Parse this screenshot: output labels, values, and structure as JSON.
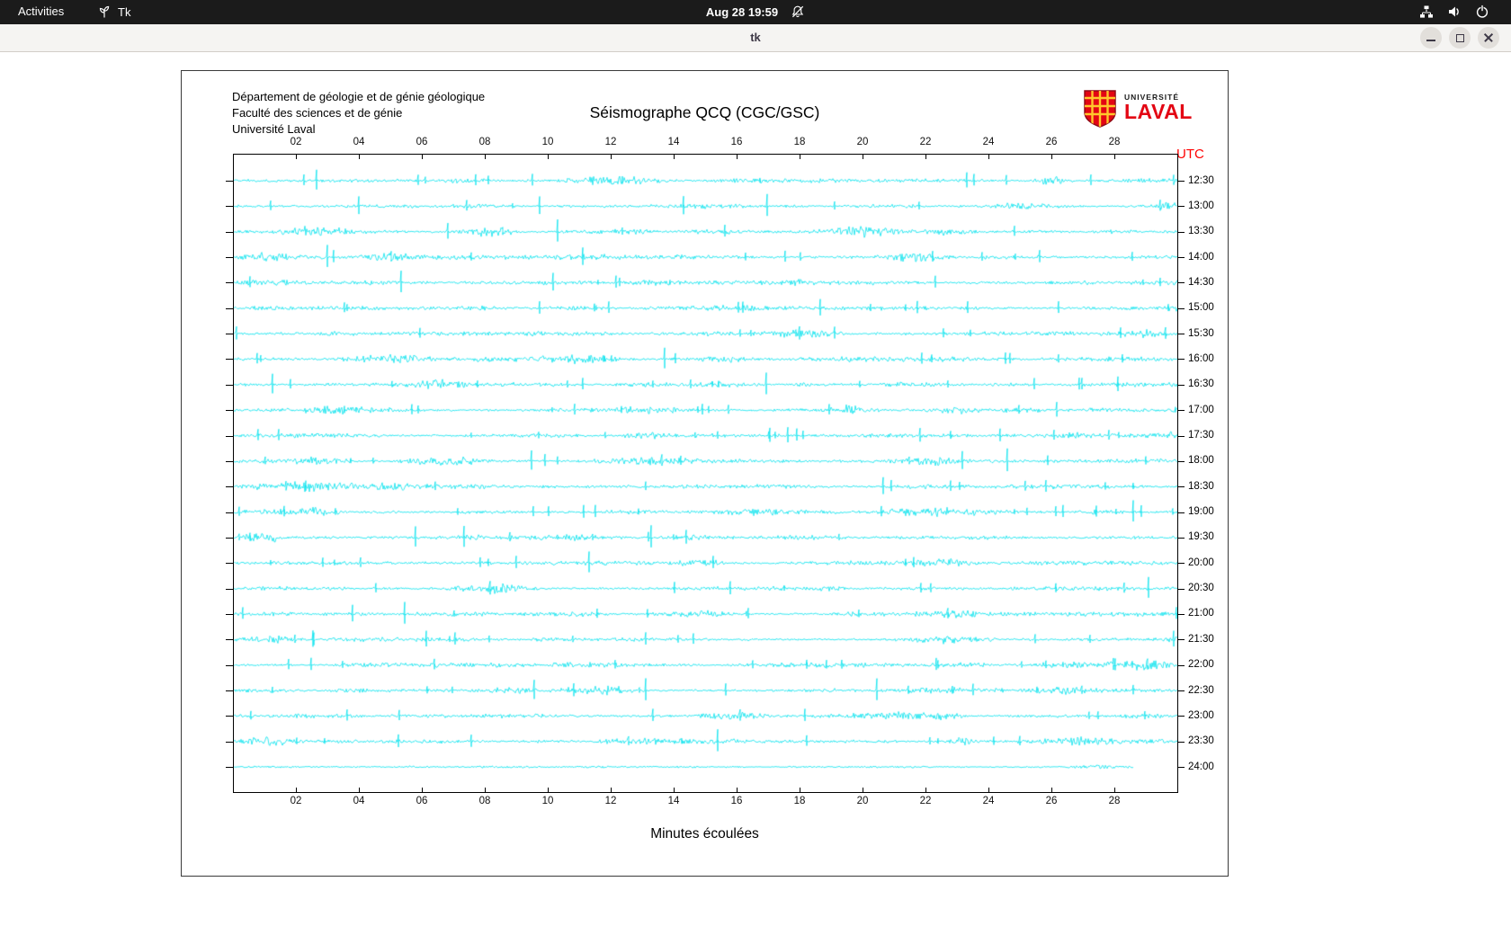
{
  "top_bar": {
    "activities": "Activities",
    "app_name": "Tk",
    "clock": "Aug 28 19:59"
  },
  "window": {
    "title": "tk"
  },
  "seismograph": {
    "institution": [
      "Département de géologie et de génie géologique",
      "Faculté des sciences et de génie",
      "Université Laval"
    ],
    "title": "Séismographe QCQ (CGC/GSC)",
    "utc_label": "UTC",
    "x_axis_title": "Minutes écoulées",
    "logo": {
      "line1": "UNIVERSITÉ",
      "line2": "LAVAL"
    },
    "colors": {
      "trace": "#00e2ee",
      "utc": "#ff0000",
      "laval_red": "#e30513",
      "laval_yellow": "#ffc72c"
    }
  },
  "chart_data": {
    "type": "line",
    "subtype": "helicorder-seismogram",
    "title": "Séismographe QCQ (CGC/GSC)",
    "xlabel": "Minutes écoulées",
    "x_ticks": [
      "02",
      "04",
      "06",
      "08",
      "10",
      "12",
      "14",
      "16",
      "18",
      "20",
      "22",
      "24",
      "26",
      "28"
    ],
    "x_range_minutes": [
      0,
      30
    ],
    "minutes_per_row": 30,
    "row_labels_utc": [
      "12:30",
      "13:00",
      "13:30",
      "14:00",
      "14:30",
      "15:00",
      "15:30",
      "16:00",
      "16:30",
      "17:00",
      "17:30",
      "18:00",
      "18:30",
      "19:00",
      "19:30",
      "20:00",
      "20:30",
      "21:00",
      "21:30",
      "22:00",
      "22:30",
      "23:00",
      "23:30",
      "24:00"
    ],
    "last_row_end_minute": 28.6,
    "signal": "continuous ambient seismic noise traces with sporadic small-amplitude spikes and short noise bursts; final (24:00) trace is quieter and ends early at ~28.6 min"
  }
}
